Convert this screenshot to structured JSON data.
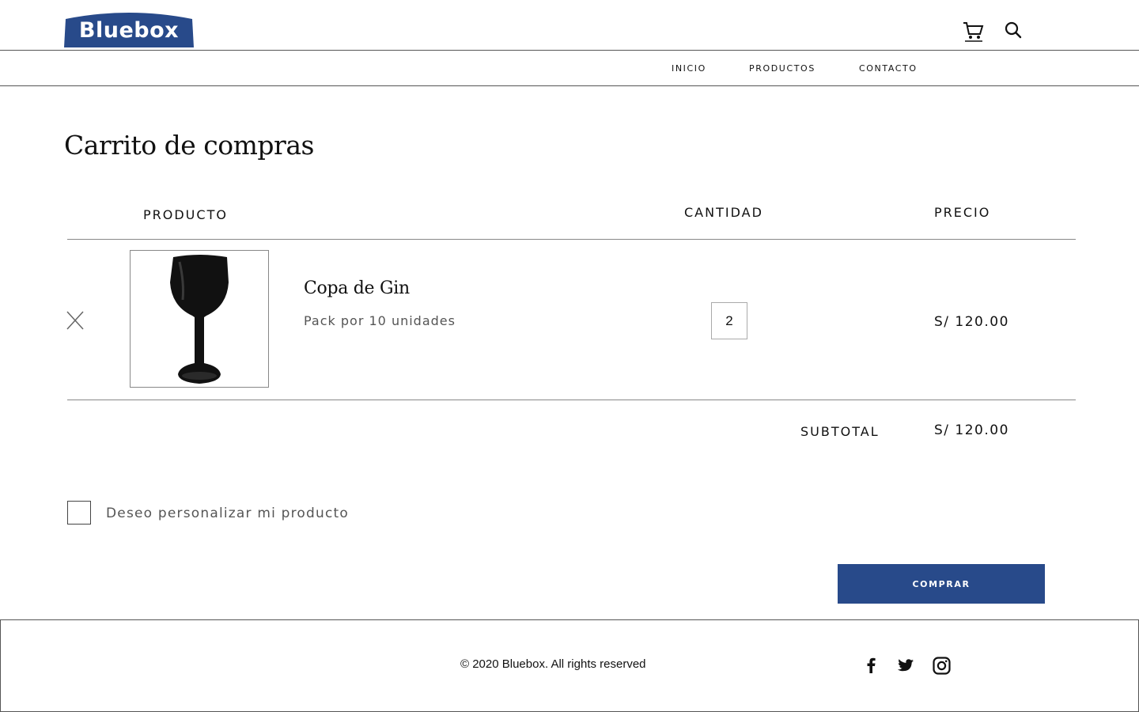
{
  "brand": {
    "name": "Bluebox",
    "color": "#284a8a"
  },
  "header": {
    "icons": [
      "cart-icon",
      "search-icon"
    ]
  },
  "nav": {
    "items": [
      {
        "label": "INICIO"
      },
      {
        "label": "PRODUCTOS"
      },
      {
        "label": "CONTACTO"
      }
    ]
  },
  "cart": {
    "title": "Carrito de compras",
    "columns": {
      "product": "PRODUCTO",
      "quantity": "CANTIDAD",
      "price": "PRECIO"
    },
    "items": [
      {
        "name": "Copa  de Gin",
        "variant": "Pack por 10 unidades",
        "quantity": "2",
        "price": "S/ 120.00",
        "image_icon": "black-gin-glass"
      }
    ],
    "subtotal_label": "SUBTOTAL",
    "subtotal_value": "S/ 120.00",
    "customize_label": "Deseo personalizar mi producto",
    "customize_checked": false,
    "buy_label": "COMPRAR"
  },
  "footer": {
    "copyright": "© 2020 Bluebox. All rights reserved",
    "social": [
      "facebook-icon",
      "twitter-icon",
      "instagram-icon"
    ]
  }
}
